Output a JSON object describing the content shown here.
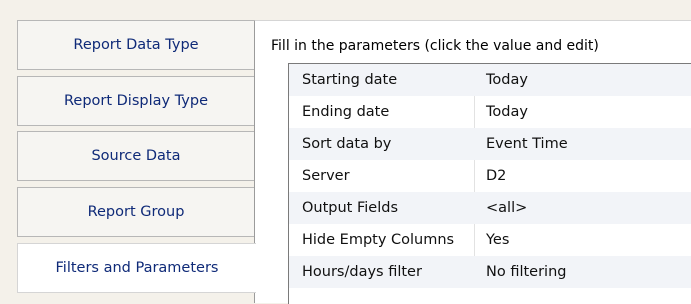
{
  "tabs": [
    {
      "label": "Report Data Type"
    },
    {
      "label": "Report Display Type"
    },
    {
      "label": "Source Data"
    },
    {
      "label": "Report Group"
    },
    {
      "label": "Filters and Parameters"
    }
  ],
  "active_tab": "Filters and Parameters",
  "instruction": "Fill in the parameters (click the value and edit)",
  "parameters": [
    {
      "name": "Starting date",
      "value": "Today"
    },
    {
      "name": "Ending date",
      "value": "Today"
    },
    {
      "name": "Sort data by",
      "value": "Event Time"
    },
    {
      "name": "Server",
      "value": "D2"
    },
    {
      "name": "Output Fields",
      "value": "<all>"
    },
    {
      "name": "Hide Empty Columns",
      "value": "Yes"
    },
    {
      "name": "Hours/days filter",
      "value": "No filtering"
    }
  ],
  "colors": {
    "tab_text": "#0f2a78",
    "background": "#f4f1ea",
    "row_alt": "#f2f4f8"
  }
}
